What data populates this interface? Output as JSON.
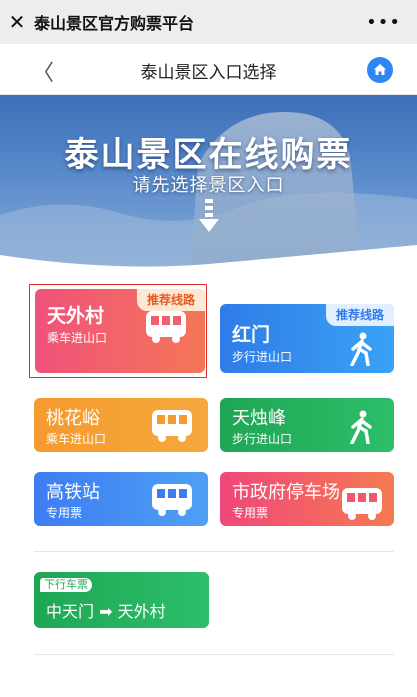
{
  "wechat": {
    "close_glyph": "✕",
    "title": "泰山景区官方购票平台",
    "more_glyph": "•••"
  },
  "nav": {
    "back_glyph": "〈",
    "title": "泰山景区入口选择",
    "home_icon": "home-icon"
  },
  "banner": {
    "title": "泰山景区在线购票",
    "subtitle": "请先选择景区入口"
  },
  "tiles": [
    {
      "name": "天外村",
      "desc": "乘车进山口",
      "badge": "推荐线路",
      "icon": "bus-icon",
      "color_from": "#f0527a",
      "color_to": "#f47657"
    },
    {
      "name": "红门",
      "desc": "步行进山口",
      "badge": "推荐线路",
      "icon": "walker-icon",
      "color_from": "#2f7be8",
      "color_to": "#3aa2f4"
    },
    {
      "name": "桃花峪",
      "desc": "乘车进山口",
      "icon": "bus-icon",
      "color_from": "#f59a2f",
      "color_to": "#f5a83c"
    },
    {
      "name": "天烛峰",
      "desc": "步行进山口",
      "icon": "walker-icon",
      "color_from": "#1fa654",
      "color_to": "#2cbe6a"
    },
    {
      "name": "高铁站",
      "desc": "专用票",
      "icon": "bus-icon",
      "color_from": "#3d7cf2",
      "color_to": "#4ea0f5"
    },
    {
      "name": "市政府停车场",
      "desc": "专用票",
      "icon": "bus-icon",
      "color_from": "#f0477a",
      "color_to": "#f57a52"
    }
  ],
  "downhill": {
    "badge": "下行车票",
    "from": "中天门",
    "arrow": "➡",
    "to": "天外村"
  }
}
